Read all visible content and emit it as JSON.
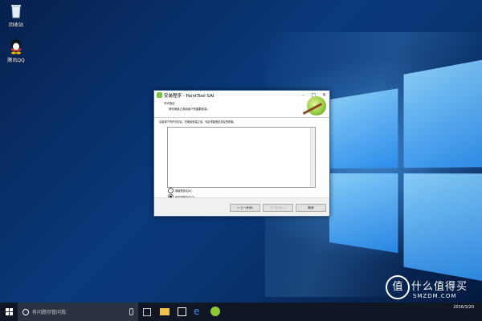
{
  "desktop": {
    "icons": [
      {
        "label": "回收站",
        "icon": "recycle-bin-icon"
      },
      {
        "label": "腾讯QQ",
        "icon": "qq-icon"
      }
    ]
  },
  "dialog": {
    "title": "安装程序 - PaintTool SAI",
    "header_line1": "许可协议",
    "header_line2": "请在继续之前阅读下列重要信息。",
    "intro": "请阅读下列许可协议。在继续安装之前，你必须接受此协议的条款。",
    "radio_accept": "我接受协议(A)",
    "radio_decline": "我不接受协议(D)",
    "btn_back": "< 上一步(B)",
    "btn_next": "下一步(N) >",
    "btn_cancel": "取消"
  },
  "taskbar": {
    "search_placeholder": "有问题尽管问我",
    "date": "2016/3/20"
  },
  "watermark": {
    "mark": "值",
    "text": "什么值得买",
    "sub": "SMZDM.COM"
  }
}
